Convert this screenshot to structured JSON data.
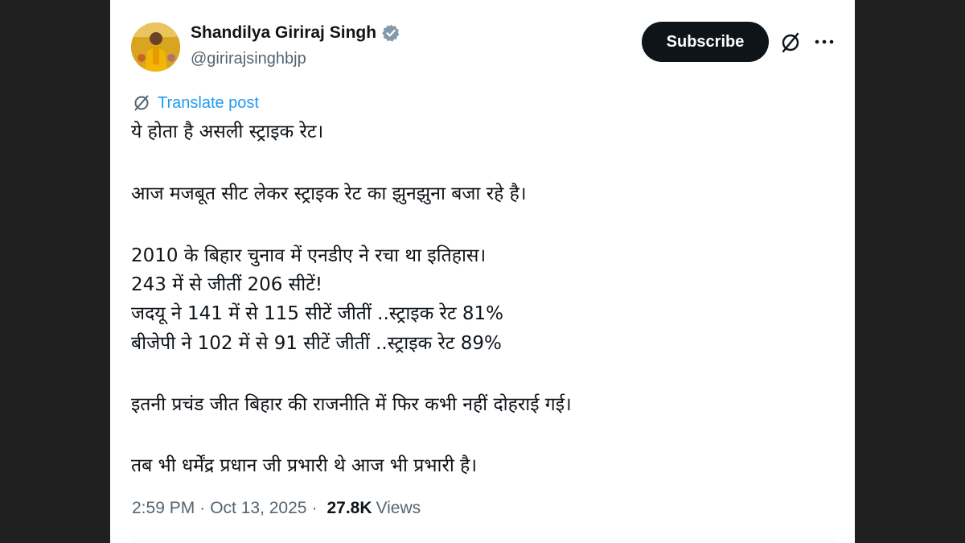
{
  "author": {
    "display_name": "Shandilya Giriraj Singh",
    "handle": "@girirajsinghbjp",
    "verified": true
  },
  "actions": {
    "subscribe_label": "Subscribe",
    "grok_icon": "grok-icon",
    "more_icon": "more-options-icon"
  },
  "translate": {
    "label": "Translate post",
    "icon": "translate-icon"
  },
  "post": {
    "lines": [
      "ये होता है असली स्ट्राइक रेट।",
      "",
      "आज मजबूत सीट लेकर स्ट्राइक रेट का झुनझुना बजा रहे है।",
      "",
      "2010 के बिहार चुनाव में एनडीए ने रचा था इतिहास।",
      "243 में से जीतीं 206 सीटें!",
      "जदयू ने 141 में से 115 सीटें जीतीं ..स्ट्राइक रेट 81%",
      "बीजेपी ने 102 में से 91 सीटें जीतीं ..स्ट्राइक रेट 89%",
      "",
      "इतनी प्रचंड जीत बिहार की राजनीति में फिर कभी नहीं दोहराई गई।",
      "",
      "तब भी धर्मेंद्र प्रधान जी प्रभारी थे आज भी प्रभारी है।"
    ]
  },
  "meta": {
    "time": "2:59 PM",
    "date": "Oct 13, 2025",
    "separator": "·",
    "views_count": "27.8K",
    "views_label": "Views"
  },
  "colors": {
    "background": "#202020",
    "card": "#ffffff",
    "text_primary": "#0f1419",
    "text_secondary": "#536471",
    "accent": "#1d9bf0",
    "button": "#0f1419"
  }
}
